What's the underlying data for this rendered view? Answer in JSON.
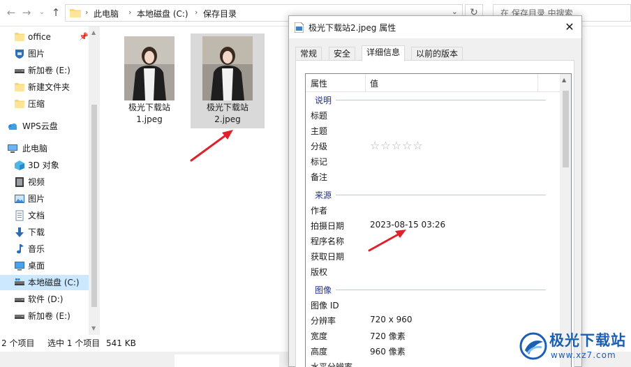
{
  "explorer": {
    "breadcrumbs": [
      "此电脑",
      "本地磁盘 (C:)",
      "保存目录"
    ],
    "search_placeholder": "在 保存目录 中搜索",
    "sidebar": {
      "items": [
        {
          "label": "office",
          "icon": "folder-icon",
          "pinned": true
        },
        {
          "label": "图片",
          "icon": "pictures-shield-icon"
        },
        {
          "label": "新加卷 (E:)",
          "icon": "drive-icon"
        },
        {
          "label": "新建文件夹",
          "icon": "folder-icon"
        },
        {
          "label": "压缩",
          "icon": "folder-icon"
        },
        {
          "label": "WPS云盘",
          "icon": "cloud-icon"
        },
        {
          "label": "此电脑",
          "icon": "computer-icon"
        },
        {
          "label": "3D 对象",
          "icon": "3d-objects-icon"
        },
        {
          "label": "视频",
          "icon": "video-icon"
        },
        {
          "label": "图片",
          "icon": "pictures-icon"
        },
        {
          "label": "文档",
          "icon": "documents-icon"
        },
        {
          "label": "下载",
          "icon": "download-icon"
        },
        {
          "label": "音乐",
          "icon": "music-icon"
        },
        {
          "label": "桌面",
          "icon": "desktop-icon"
        },
        {
          "label": "本地磁盘 (C:)",
          "icon": "system-drive-icon",
          "selected": true
        },
        {
          "label": "软件 (D:)",
          "icon": "drive-icon"
        },
        {
          "label": "新加卷 (E:)",
          "icon": "drive-icon"
        }
      ]
    },
    "files": [
      {
        "name": "极光下载站1.jpeg",
        "selected": false
      },
      {
        "name": "极光下载站2.jpeg",
        "selected": true
      }
    ],
    "status": {
      "count": "2 个项目",
      "selection": "选中 1 个项目",
      "size": "541 KB"
    }
  },
  "dialog": {
    "title": "极光下载站2.jpeg 属性",
    "tabs": [
      "常规",
      "安全",
      "详细信息",
      "以前的版本"
    ],
    "active_tab": "详细信息",
    "columns": {
      "property": "属性",
      "value": "值"
    },
    "sections": [
      {
        "name": "说明",
        "rows": [
          {
            "key": "标题",
            "value": ""
          },
          {
            "key": "主题",
            "value": ""
          },
          {
            "key": "分级",
            "value": "",
            "stars": 0,
            "stars_max": 5
          },
          {
            "key": "标记",
            "value": ""
          },
          {
            "key": "备注",
            "value": ""
          }
        ]
      },
      {
        "name": "来源",
        "rows": [
          {
            "key": "作者",
            "value": ""
          },
          {
            "key": "拍摄日期",
            "value": "2023-08-15 03:26"
          },
          {
            "key": "程序名称",
            "value": ""
          },
          {
            "key": "获取日期",
            "value": ""
          },
          {
            "key": "版权",
            "value": ""
          }
        ]
      },
      {
        "name": "图像",
        "rows": [
          {
            "key": "图像 ID",
            "value": ""
          },
          {
            "key": "分辨率",
            "value": "720 x 960"
          },
          {
            "key": "宽度",
            "value": "720 像素"
          },
          {
            "key": "高度",
            "value": "960 像素"
          },
          {
            "key": "水平分辨率",
            "value": ""
          }
        ]
      }
    ]
  },
  "watermark": {
    "text": "极光下载站",
    "url": "www.xz7.com"
  },
  "colors": {
    "selection": "#cce8ff",
    "section_header": "#1e3287",
    "annotation_arrow": "#e0202a",
    "watermark": "#1b5fb4"
  }
}
